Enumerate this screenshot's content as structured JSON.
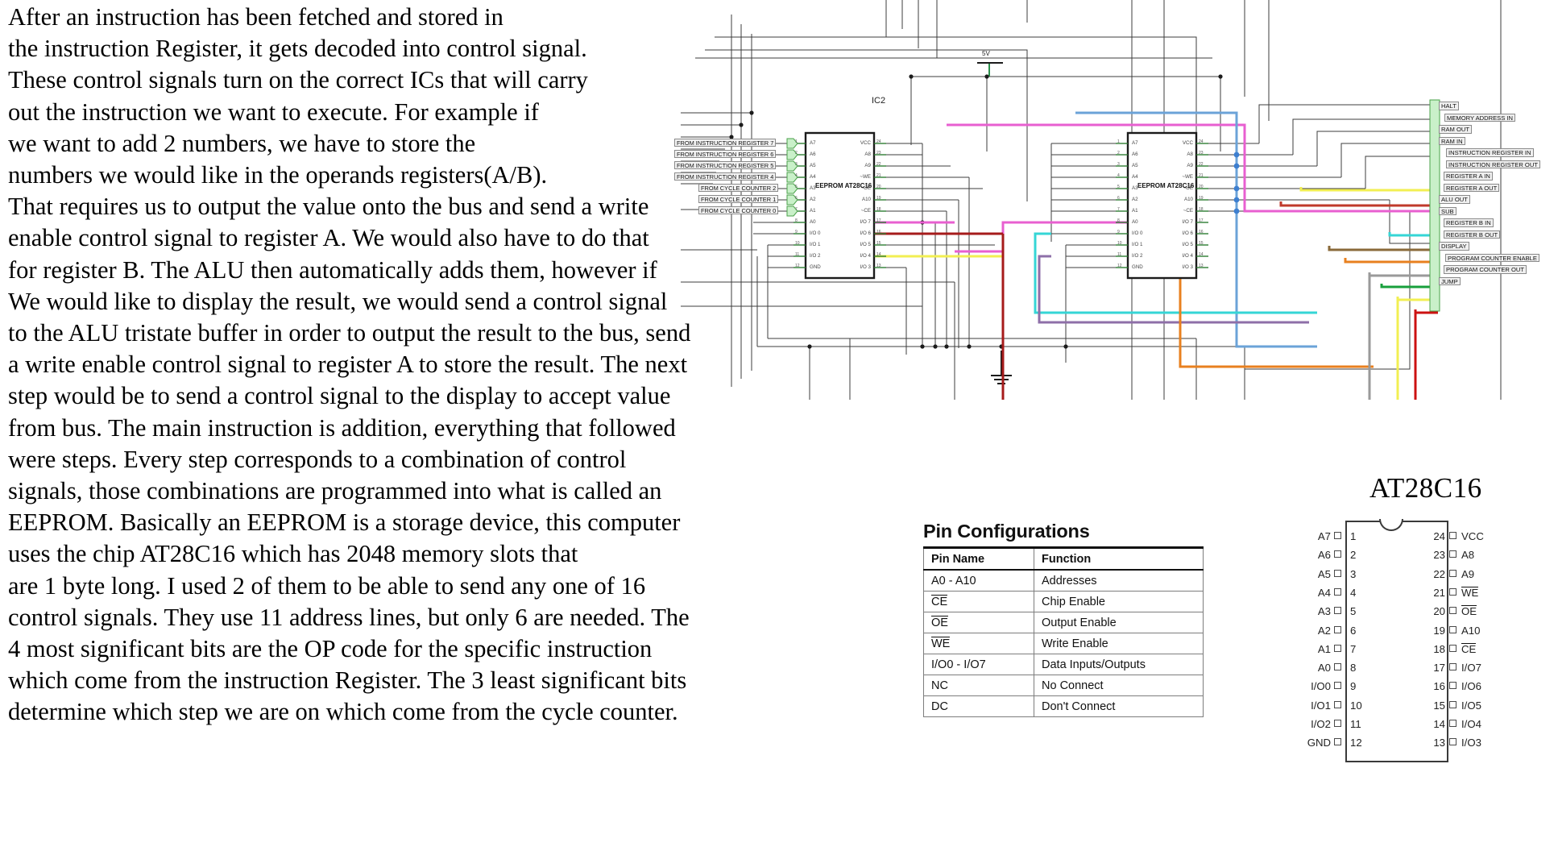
{
  "essay": {
    "lines": [
      "After an instruction has been fetched and stored in",
      "the instruction Register, it gets decoded into control signal.",
      "These control signals turn on the correct ICs that will carry",
      "out the instruction we want to execute. For example if",
      "we want to add 2 numbers, we have to store the",
      "numbers we would like in the operands registers(A/B).",
      "That requires us to output the value onto the bus and send a write",
      "enable control signal to register A. We would also have to do that",
      "for register B. The ALU then automatically adds them, however if",
      "We would like to display the result, we would send a control signal",
      "to the ALU tristate buffer in order to output the result to the bus, send",
      "a write enable control signal to register A to store the result. The next",
      "step would be to send a control signal to the display to accept value",
      "from bus. The main instruction is addition, everything that followed",
      "were steps. Every step corresponds to a combination of control",
      "signals, those combinations are programmed into what is called an",
      "EEPROM. Basically an EEPROM is a storage device, this computer",
      "uses the chip AT28C16 which has 2048 memory slots that",
      "are 1 byte long. I used 2 of them to be able to send any one of 16",
      "control signals. They use 11 address lines, but only 6 are needed. The",
      "4 most significant bits are the OP code for the specific instruction",
      "which come from the instruction Register. The 3 least significant bits",
      "determine which step we are on which come from the cycle counter."
    ]
  },
  "schematic": {
    "supply_label": "5V",
    "ic_designator": "IC2",
    "chip_label": "EEPROM AT28C16",
    "input_labels": [
      "FROM INSTRUCTION REGISTER 7",
      "FROM INSTRUCTION REGISTER 6",
      "FROM INSTRUCTION REGISTER 5",
      "FROM INSTRUCTION REGISTER 4",
      "FROM CYCLE COUNTER 2",
      "FROM CYCLE COUNTER 1",
      "FROM CYCLE COUNTER 0"
    ],
    "control_labels": [
      {
        "text": "HALT",
        "wire_color": "#333333"
      },
      {
        "text": "MEMORY ADDRESS IN",
        "wire_color": "#333333"
      },
      {
        "text": "RAM OUT",
        "wire_color": "#333333"
      },
      {
        "text": "RAM IN",
        "wire_color": "#333333"
      },
      {
        "text": "INSTRUCTION REGISTER IN",
        "wire_color": "#333333"
      },
      {
        "text": "INSTRUCTION REGISTER OUT",
        "wire_color": "#e8e000"
      },
      {
        "text": "REGISTER A IN",
        "wire_color": "#c0392b"
      },
      {
        "text": "REGISTER A OUT",
        "wire_color": "#e85fd0"
      },
      {
        "text": "ALU OUT",
        "wire_color": "#8e6fa8"
      },
      {
        "text": "SUB",
        "wire_color": "#35d6d6"
      },
      {
        "text": "REGISTER B IN",
        "wire_color": "#8a6a3a"
      },
      {
        "text": "REGISTER B OUT",
        "wire_color": "#e8801f"
      },
      {
        "text": "DISPLAY",
        "wire_color": "#9a9a9a"
      },
      {
        "text": "PROGRAM COUNTER ENABLE",
        "wire_color": "#18a03c"
      },
      {
        "text": "PROGRAM COUNTER OUT",
        "wire_color": "#e8e000"
      },
      {
        "text": "JUMP",
        "wire_color": "#cc1111"
      }
    ],
    "chip_left_pins": [
      "A7",
      "A6",
      "A5",
      "A4",
      "A3",
      "A2",
      "A1",
      "A0",
      "I/O 0",
      "I/O 1",
      "I/O 2",
      "GND"
    ],
    "chip_right_pins": [
      "VCC",
      "A8",
      "A9",
      "~WE",
      "~OE",
      "A10",
      "~CE",
      "I/O 7",
      "I/O 6",
      "I/O 5",
      "I/O 4",
      "I/O 3"
    ],
    "chip_left_nums": [
      "1",
      "2",
      "3",
      "4",
      "5",
      "6",
      "7",
      "8",
      "9",
      "10",
      "11",
      "12"
    ],
    "chip_right_nums": [
      "24",
      "23",
      "22",
      "21",
      "20",
      "19",
      "18",
      "17",
      "16",
      "15",
      "14",
      "13"
    ]
  },
  "caption": {
    "at28c16": "AT28C16"
  },
  "pin_configurations": {
    "title": "Pin Configurations",
    "headers": [
      "Pin Name",
      "Function"
    ],
    "rows": [
      {
        "name": "A0 - A10",
        "overline": false,
        "function": "Addresses"
      },
      {
        "name": "CE",
        "overline": true,
        "function": "Chip Enable"
      },
      {
        "name": "OE",
        "overline": true,
        "function": "Output Enable"
      },
      {
        "name": "WE",
        "overline": true,
        "function": "Write Enable"
      },
      {
        "name": "I/O0 - I/O7",
        "overline": false,
        "function": "Data Inputs/Outputs"
      },
      {
        "name": "NC",
        "overline": false,
        "function": "No Connect"
      },
      {
        "name": "DC",
        "overline": false,
        "function": "Don't Connect"
      }
    ]
  },
  "dip_package": {
    "left_pins": [
      {
        "num": "1",
        "label": "A7",
        "overline": false
      },
      {
        "num": "2",
        "label": "A6",
        "overline": false
      },
      {
        "num": "3",
        "label": "A5",
        "overline": false
      },
      {
        "num": "4",
        "label": "A4",
        "overline": false
      },
      {
        "num": "5",
        "label": "A3",
        "overline": false
      },
      {
        "num": "6",
        "label": "A2",
        "overline": false
      },
      {
        "num": "7",
        "label": "A1",
        "overline": false
      },
      {
        "num": "8",
        "label": "A0",
        "overline": false
      },
      {
        "num": "9",
        "label": "I/O0",
        "overline": false
      },
      {
        "num": "10",
        "label": "I/O1",
        "overline": false
      },
      {
        "num": "11",
        "label": "I/O2",
        "overline": false
      },
      {
        "num": "12",
        "label": "GND",
        "overline": false
      }
    ],
    "right_pins": [
      {
        "num": "24",
        "label": "VCC",
        "overline": false
      },
      {
        "num": "23",
        "label": "A8",
        "overline": false
      },
      {
        "num": "22",
        "label": "A9",
        "overline": false
      },
      {
        "num": "21",
        "label": "WE",
        "overline": true
      },
      {
        "num": "20",
        "label": "OE",
        "overline": true
      },
      {
        "num": "19",
        "label": "A10",
        "overline": false
      },
      {
        "num": "18",
        "label": "CE",
        "overline": true
      },
      {
        "num": "17",
        "label": "I/O7",
        "overline": false
      },
      {
        "num": "16",
        "label": "I/O6",
        "overline": false
      },
      {
        "num": "15",
        "label": "I/O5",
        "overline": false
      },
      {
        "num": "14",
        "label": "I/O4",
        "overline": false
      },
      {
        "num": "13",
        "label": "I/O3",
        "overline": false
      }
    ]
  }
}
